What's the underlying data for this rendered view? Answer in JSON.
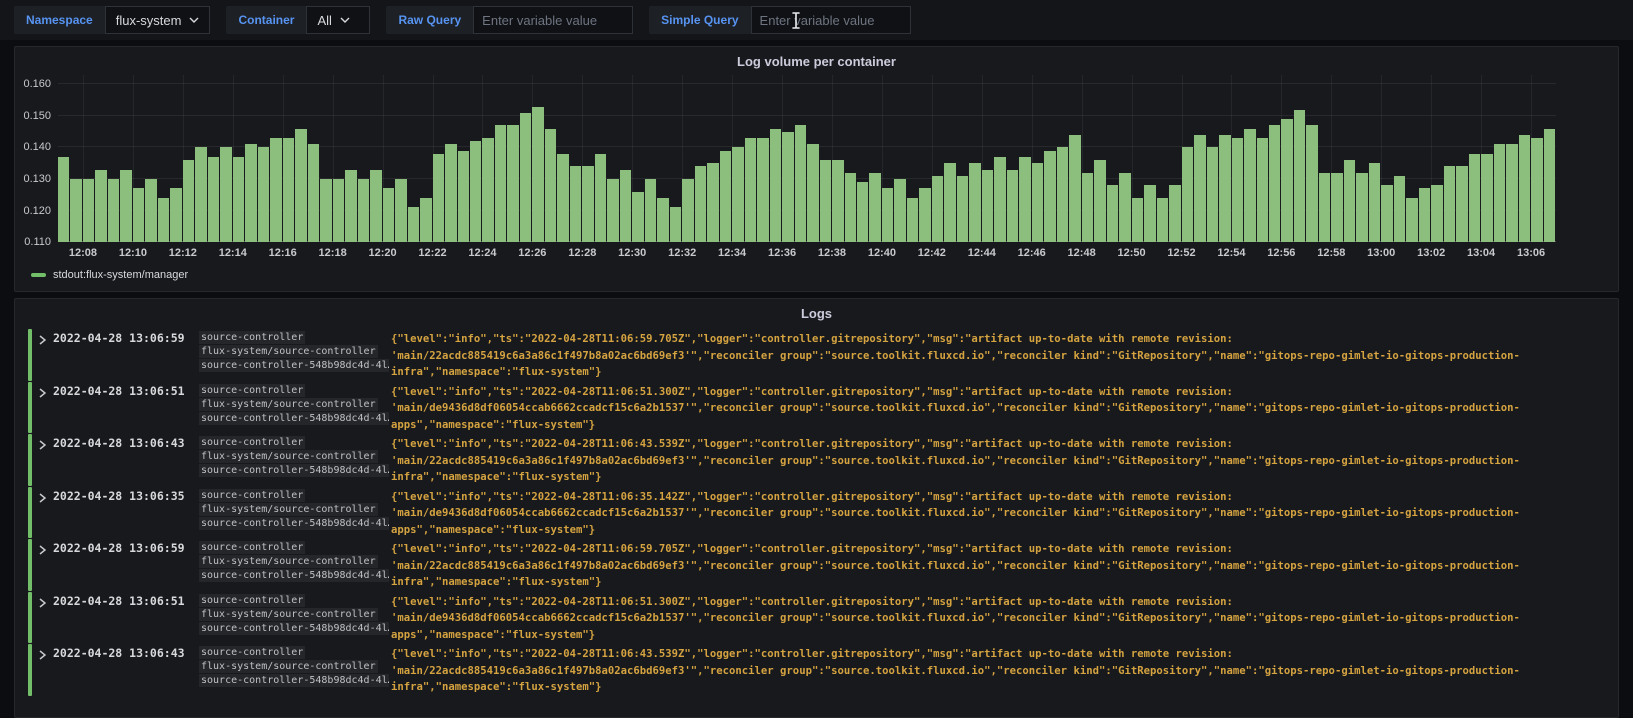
{
  "icons": {
    "dropdown_caret": "chevron-down",
    "log_expand": "chevron-right",
    "mouse_cursor": "i-beam-text-cursor"
  },
  "colors": {
    "accent_blue": "#5794f2",
    "series_green": "#8cbe7d",
    "legend_green": "#73bf69",
    "log_json_gold": "#d5a340",
    "panel_bg": "#17191d"
  },
  "toolbar": {
    "variables": [
      {
        "label": "Namespace",
        "type": "select",
        "value": "flux-system"
      },
      {
        "label": "Container",
        "type": "select",
        "value": "All"
      },
      {
        "label": "Raw Query",
        "type": "input",
        "value": "",
        "placeholder": "Enter variable value"
      },
      {
        "label": "Simple Query",
        "type": "input",
        "value": "",
        "placeholder": "Enter variable value"
      }
    ]
  },
  "chart_panel": {
    "title": "Log volume per container",
    "legend": "stdout:flux-system/manager"
  },
  "chart_data": {
    "type": "bar",
    "title": "Log volume per container",
    "interval_seconds": 30,
    "start_time": "12:07",
    "end_time": "13:07",
    "x_ticks": [
      "12:08",
      "12:10",
      "12:12",
      "12:14",
      "12:16",
      "12:18",
      "12:20",
      "12:22",
      "12:24",
      "12:26",
      "12:28",
      "12:30",
      "12:32",
      "12:34",
      "12:36",
      "12:38",
      "12:40",
      "12:42",
      "12:44",
      "12:46",
      "12:48",
      "12:50",
      "12:52",
      "12:54",
      "12:56",
      "12:58",
      "13:00",
      "13:02",
      "13:04",
      "13:06"
    ],
    "y_ticks": [
      "0.160",
      "0.150",
      "0.140",
      "0.130",
      "0.120",
      "0.110"
    ],
    "ylim": [
      0.11,
      0.163
    ],
    "grid": true,
    "legend_position": "bottom-left",
    "series": [
      {
        "name": "stdout:flux-system/manager",
        "color": "#8cbe7d",
        "values": [
          0.137,
          0.13,
          0.13,
          0.133,
          0.13,
          0.133,
          0.127,
          0.13,
          0.124,
          0.127,
          0.136,
          0.14,
          0.137,
          0.14,
          0.137,
          0.141,
          0.14,
          0.143,
          0.143,
          0.146,
          0.141,
          0.13,
          0.13,
          0.133,
          0.13,
          0.133,
          0.127,
          0.13,
          0.121,
          0.124,
          0.138,
          0.141,
          0.139,
          0.142,
          0.143,
          0.147,
          0.147,
          0.151,
          0.153,
          0.146,
          0.138,
          0.134,
          0.134,
          0.138,
          0.13,
          0.133,
          0.126,
          0.13,
          0.124,
          0.121,
          0.13,
          0.134,
          0.135,
          0.139,
          0.14,
          0.143,
          0.143,
          0.146,
          0.145,
          0.147,
          0.141,
          0.136,
          0.136,
          0.132,
          0.129,
          0.132,
          0.127,
          0.13,
          0.124,
          0.127,
          0.131,
          0.135,
          0.131,
          0.135,
          0.133,
          0.137,
          0.133,
          0.137,
          0.135,
          0.139,
          0.14,
          0.144,
          0.132,
          0.136,
          0.128,
          0.132,
          0.124,
          0.128,
          0.124,
          0.128,
          0.14,
          0.144,
          0.14,
          0.144,
          0.143,
          0.146,
          0.143,
          0.147,
          0.149,
          0.152,
          0.147,
          0.132,
          0.132,
          0.136,
          0.132,
          0.135,
          0.128,
          0.131,
          0.124,
          0.127,
          0.128,
          0.134,
          0.134,
          0.138,
          0.138,
          0.141,
          0.141,
          0.144,
          0.143,
          0.146
        ]
      }
    ]
  },
  "logs_panel": {
    "title": "Logs",
    "rows": [
      {
        "date": "2022-04-28",
        "time": "13:06:59",
        "labels": [
          "source-controller",
          "flux-system/source-controller",
          "source-controller-548b98dc4d-4l…"
        ],
        "message": "{\"level\":\"info\",\"ts\":\"2022-04-28T11:06:59.705Z\",\"logger\":\"controller.gitrepository\",\"msg\":\"artifact up-to-date with remote revision: 'main/22acdc885419c6a3a86c1f497b8a02ac6bd69ef3'\",\"reconciler group\":\"source.toolkit.fluxcd.io\",\"reconciler kind\":\"GitRepository\",\"name\":\"gitops-repo-gimlet-io-gitops-production-infra\",\"namespace\":\"flux-system\"}"
      },
      {
        "date": "2022-04-28",
        "time": "13:06:51",
        "labels": [
          "source-controller",
          "flux-system/source-controller",
          "source-controller-548b98dc4d-4l…"
        ],
        "message": "{\"level\":\"info\",\"ts\":\"2022-04-28T11:06:51.300Z\",\"logger\":\"controller.gitrepository\",\"msg\":\"artifact up-to-date with remote revision: 'main/de9436d8df06054ccab6662ccadcf15c6a2b1537'\",\"reconciler group\":\"source.toolkit.fluxcd.io\",\"reconciler kind\":\"GitRepository\",\"name\":\"gitops-repo-gimlet-io-gitops-production-apps\",\"namespace\":\"flux-system\"}"
      },
      {
        "date": "2022-04-28",
        "time": "13:06:43",
        "labels": [
          "source-controller",
          "flux-system/source-controller",
          "source-controller-548b98dc4d-4l…"
        ],
        "message": "{\"level\":\"info\",\"ts\":\"2022-04-28T11:06:43.539Z\",\"logger\":\"controller.gitrepository\",\"msg\":\"artifact up-to-date with remote revision: 'main/22acdc885419c6a3a86c1f497b8a02ac6bd69ef3'\",\"reconciler group\":\"source.toolkit.fluxcd.io\",\"reconciler kind\":\"GitRepository\",\"name\":\"gitops-repo-gimlet-io-gitops-production-infra\",\"namespace\":\"flux-system\"}"
      },
      {
        "date": "2022-04-28",
        "time": "13:06:35",
        "labels": [
          "source-controller",
          "flux-system/source-controller",
          "source-controller-548b98dc4d-4l…"
        ],
        "message": "{\"level\":\"info\",\"ts\":\"2022-04-28T11:06:35.142Z\",\"logger\":\"controller.gitrepository\",\"msg\":\"artifact up-to-date with remote revision: 'main/de9436d8df06054ccab6662ccadcf15c6a2b1537'\",\"reconciler group\":\"source.toolkit.fluxcd.io\",\"reconciler kind\":\"GitRepository\",\"name\":\"gitops-repo-gimlet-io-gitops-production-apps\",\"namespace\":\"flux-system\"}"
      },
      {
        "date": "2022-04-28",
        "time": "13:06:59",
        "labels": [
          "source-controller",
          "flux-system/source-controller",
          "source-controller-548b98dc4d-4l…"
        ],
        "message": "{\"level\":\"info\",\"ts\":\"2022-04-28T11:06:59.705Z\",\"logger\":\"controller.gitrepository\",\"msg\":\"artifact up-to-date with remote revision: 'main/22acdc885419c6a3a86c1f497b8a02ac6bd69ef3'\",\"reconciler group\":\"source.toolkit.fluxcd.io\",\"reconciler kind\":\"GitRepository\",\"name\":\"gitops-repo-gimlet-io-gitops-production-infra\",\"namespace\":\"flux-system\"}"
      },
      {
        "date": "2022-04-28",
        "time": "13:06:51",
        "labels": [
          "source-controller",
          "flux-system/source-controller",
          "source-controller-548b98dc4d-4l…"
        ],
        "message": "{\"level\":\"info\",\"ts\":\"2022-04-28T11:06:51.300Z\",\"logger\":\"controller.gitrepository\",\"msg\":\"artifact up-to-date with remote revision: 'main/de9436d8df06054ccab6662ccadcf15c6a2b1537'\",\"reconciler group\":\"source.toolkit.fluxcd.io\",\"reconciler kind\":\"GitRepository\",\"name\":\"gitops-repo-gimlet-io-gitops-production-apps\",\"namespace\":\"flux-system\"}"
      },
      {
        "date": "2022-04-28",
        "time": "13:06:43",
        "labels": [
          "source-controller",
          "flux-system/source-controller",
          "source-controller-548b98dc4d-4l…"
        ],
        "message": "{\"level\":\"info\",\"ts\":\"2022-04-28T11:06:43.539Z\",\"logger\":\"controller.gitrepository\",\"msg\":\"artifact up-to-date with remote revision: 'main/22acdc885419c6a3a86c1f497b8a02ac6bd69ef3'\",\"reconciler group\":\"source.toolkit.fluxcd.io\",\"reconciler kind\":\"GitRepository\",\"name\":\"gitops-repo-gimlet-io-gitops-production-infra\",\"namespace\":\"flux-system\"}"
      }
    ]
  }
}
